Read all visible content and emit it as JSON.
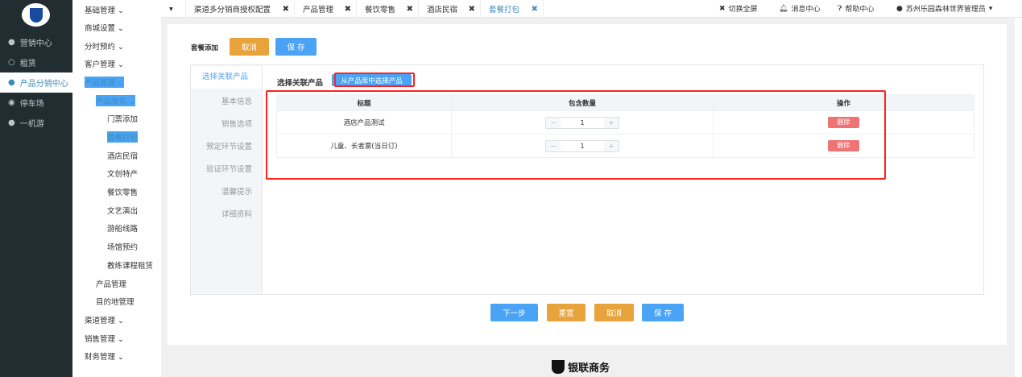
{
  "sidebar": {
    "items": [
      {
        "label": "营销中心",
        "icon": "user-icon"
      },
      {
        "label": "租赁",
        "icon": "circle-icon"
      },
      {
        "label": "产品分销中心",
        "icon": "user-icon",
        "active": true
      },
      {
        "label": "停车场",
        "icon": "disc-icon"
      },
      {
        "label": "一机游",
        "icon": "user-icon"
      }
    ]
  },
  "submenu": {
    "items": [
      "基础管理",
      "商城设置",
      "分时预约",
      "客户管理",
      "产品管理"
    ],
    "publish": "产品发布",
    "publish_items": [
      "门票添加",
      "套餐打包",
      "酒店民宿",
      "文创特产",
      "餐饮零售",
      "文艺演出",
      "游船线路",
      "场馆预约",
      "教练课程租赁"
    ],
    "level2": [
      "产品管理",
      "目的地管理"
    ],
    "bottom": [
      "渠道管理",
      "销售管理",
      "财务管理"
    ]
  },
  "tabs": [
    "渠道多分销商授权配置",
    "产品管理",
    "餐饮零售",
    "酒店民宿",
    "套餐打包"
  ],
  "topright": {
    "fullscreen": "切换全屏",
    "messages": "消息中心",
    "help": "帮助中心",
    "user": "苏州乐园森林世界管理员"
  },
  "header": {
    "title": "套餐添加",
    "cancel": "取消",
    "save": "保 存"
  },
  "vtabs": [
    "选择关联产品",
    "基本信息",
    "销售选项",
    "预定环节设置",
    "验证环节设置",
    "温馨提示",
    "详细资料"
  ],
  "section": {
    "title": "选择关联产品",
    "pick_button": "从产品库中选择产品"
  },
  "table": {
    "headers": [
      "标题",
      "包含数量",
      "操作"
    ],
    "rows": [
      {
        "title": "酒店产品测试",
        "qty": "1",
        "action": "删除"
      },
      {
        "title": "儿童、长者票(当日订)",
        "qty": "1",
        "action": "删除"
      }
    ]
  },
  "footer_buttons": {
    "next": "下一步",
    "reset": "重置",
    "cancel": "取消",
    "save": "保 存"
  },
  "brand": "银联商务"
}
